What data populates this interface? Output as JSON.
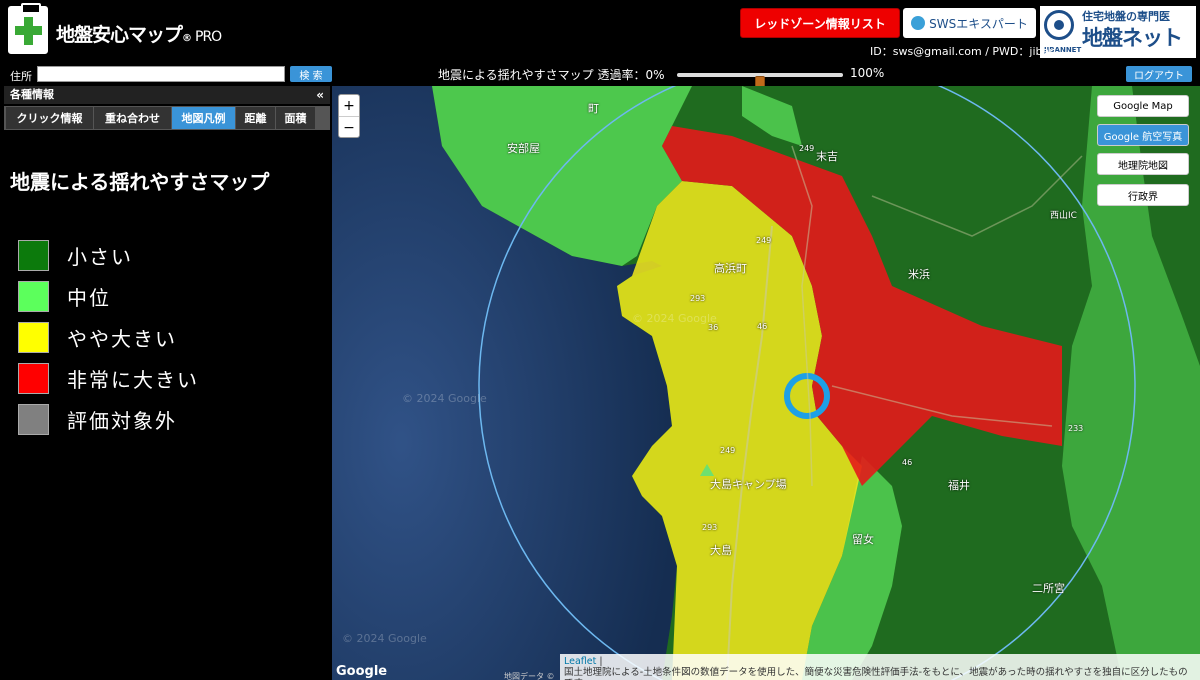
{
  "header": {
    "app_title": "地盤安心マップ",
    "app_title_reg": "®",
    "app_title_pro": "PRO",
    "red_zone_button": "レッドゾーン情報リスト",
    "sws_button": "SWSエキスパート",
    "jiban_logo_top": "住宅地盤の専門医",
    "jiban_logo_main": "地盤ネット",
    "jiban_logo_small": "JIBANNET",
    "login_info": "ID：sws@gmail.com / PWD：jiban"
  },
  "toolbar": {
    "address_label": "住所",
    "address_value": "",
    "search_button": "検 索",
    "opacity_label": "地震による揺れやすさマップ 透過率：0%",
    "opacity_max_label": "100%",
    "opacity_value_fraction": 0.5,
    "logout_button": "ログアウト"
  },
  "side_panel": {
    "header": "各種情報",
    "collapse_icon": "«",
    "tabs": [
      {
        "label": "クリック情報"
      },
      {
        "label": "重ね合わせ"
      },
      {
        "label": "地図凡例"
      },
      {
        "label": "距離"
      },
      {
        "label": "面積"
      }
    ],
    "active_tab": 2,
    "legend_title": "地震による揺れやすさマップ",
    "legend_items": [
      {
        "label": "小さい",
        "color": "#0c7a0c"
      },
      {
        "label": "中位",
        "color": "#5cff5c"
      },
      {
        "label": "やや大きい",
        "color": "#ffff00"
      },
      {
        "label": "非常に大きい",
        "color": "#ff0000"
      },
      {
        "label": "評価対象外",
        "color": "#808080"
      }
    ]
  },
  "map": {
    "zoom_in": "+",
    "zoom_out": "−",
    "layer_buttons": [
      {
        "label": "Google Map",
        "active": false
      },
      {
        "label": "Google 航空写真",
        "active": true
      },
      {
        "label": "地理院地図",
        "active": false
      },
      {
        "label": "行政界",
        "active": false
      }
    ],
    "places": [
      "町",
      "安部屋",
      "末吉",
      "高浜町",
      "米浜",
      "大島キャンプ場",
      "大島",
      "留女",
      "福井",
      "二所宮",
      "西山IC"
    ],
    "route_labels": [
      "249",
      "249",
      "293",
      "36",
      "46",
      "249",
      "293",
      "46",
      "233"
    ],
    "watermarks": [
      "© 2024 Google",
      "© 2024 Google",
      "© 2024 Google"
    ],
    "google_mark": "Google",
    "terms": "地図データ ©",
    "attribution_leaflet": "Leaflet",
    "attribution_text": "国土地理院による-土地条件図の数値データを使用した、簡便な災害危険性評価手法-をもとに、地震があった時の揺れやすさを独自に区分したものです。"
  }
}
